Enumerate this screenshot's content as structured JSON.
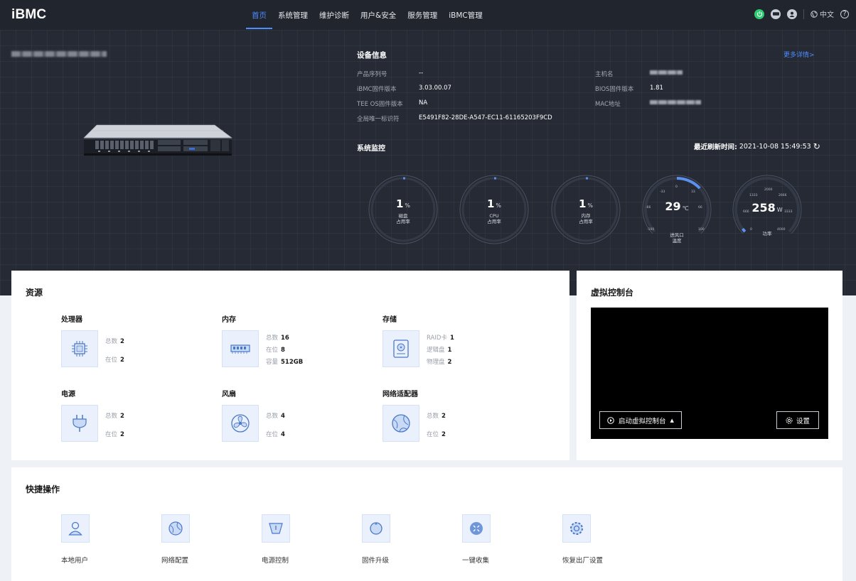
{
  "header": {
    "logo": "iBMC",
    "nav": [
      "首页",
      "系统管理",
      "维护诊断",
      "用户&安全",
      "服务管理",
      "iBMC管理"
    ],
    "active_nav": 0,
    "lang": "中文",
    "help": "?"
  },
  "device_info": {
    "title": "设备信息",
    "more": "更多详情>",
    "left": [
      {
        "label": "产品序列号",
        "value": "--"
      },
      {
        "label": "iBMC固件版本",
        "value": "3.03.00.07"
      },
      {
        "label": "TEE OS固件版本",
        "value": "NA"
      },
      {
        "label": "全局唯一标识符",
        "value": "E5491F82-28DE-A547-EC11-61165203F9CD"
      }
    ],
    "right": [
      {
        "label": "主机名",
        "value": ""
      },
      {
        "label": "BIOS固件版本",
        "value": "1.81"
      },
      {
        "label": "MAC地址",
        "value": ""
      }
    ]
  },
  "monitor": {
    "title": "系统监控",
    "refresh_label": "最近刷新时间:",
    "refresh_time": "2021-10-08 15:49:53",
    "gauges": [
      {
        "value": "1",
        "unit": "%",
        "label1": "磁盘",
        "label2": "占用率",
        "fraction": 0.01
      },
      {
        "value": "1",
        "unit": "%",
        "label1": "CPU",
        "label2": "占用率",
        "fraction": 0.01
      },
      {
        "value": "1",
        "unit": "%",
        "label1": "内存",
        "label2": "占用率",
        "fraction": 0.01
      },
      {
        "value": "29",
        "unit": "℃",
        "label1": "进风口",
        "label2": "温度",
        "fraction": 0.64,
        "ticks": [
          "-100",
          "-66",
          "-33",
          "0",
          "33",
          "66",
          "100"
        ]
      },
      {
        "value": "258",
        "unit": "W",
        "label1": "功率",
        "label2": "",
        "fraction": 0.04,
        "ticks": [
          "0",
          "666",
          "1333",
          "2000",
          "2666",
          "3333",
          "4000"
        ]
      }
    ]
  },
  "resources": {
    "title": "资源",
    "items": [
      {
        "name": "处理器",
        "stats": [
          {
            "k": "总数",
            "v": "2"
          },
          {
            "k": "在位",
            "v": "2"
          }
        ]
      },
      {
        "name": "内存",
        "stats": [
          {
            "k": "总数",
            "v": "16"
          },
          {
            "k": "在位",
            "v": "8"
          },
          {
            "k": "容量",
            "v": "512GB"
          }
        ]
      },
      {
        "name": "存储",
        "stats": [
          {
            "k": "RAID卡",
            "v": "1"
          },
          {
            "k": "逻辑盘",
            "v": "1"
          },
          {
            "k": "物理盘",
            "v": "2"
          }
        ]
      },
      {
        "name": "电源",
        "stats": [
          {
            "k": "总数",
            "v": "2"
          },
          {
            "k": "在位",
            "v": "2"
          }
        ]
      },
      {
        "name": "风扇",
        "stats": [
          {
            "k": "总数",
            "v": "4"
          },
          {
            "k": "在位",
            "v": "4"
          }
        ]
      },
      {
        "name": "网络适配器",
        "stats": [
          {
            "k": "总数",
            "v": "2"
          },
          {
            "k": "在位",
            "v": "2"
          }
        ]
      }
    ]
  },
  "console": {
    "title": "虚拟控制台",
    "launch": "启动虚拟控制台",
    "settings": "设置"
  },
  "quick": {
    "title": "快捷操作",
    "items": [
      "本地用户",
      "网络配置",
      "电源控制",
      "固件升级",
      "一键收集",
      "恢复出厂设置"
    ]
  }
}
